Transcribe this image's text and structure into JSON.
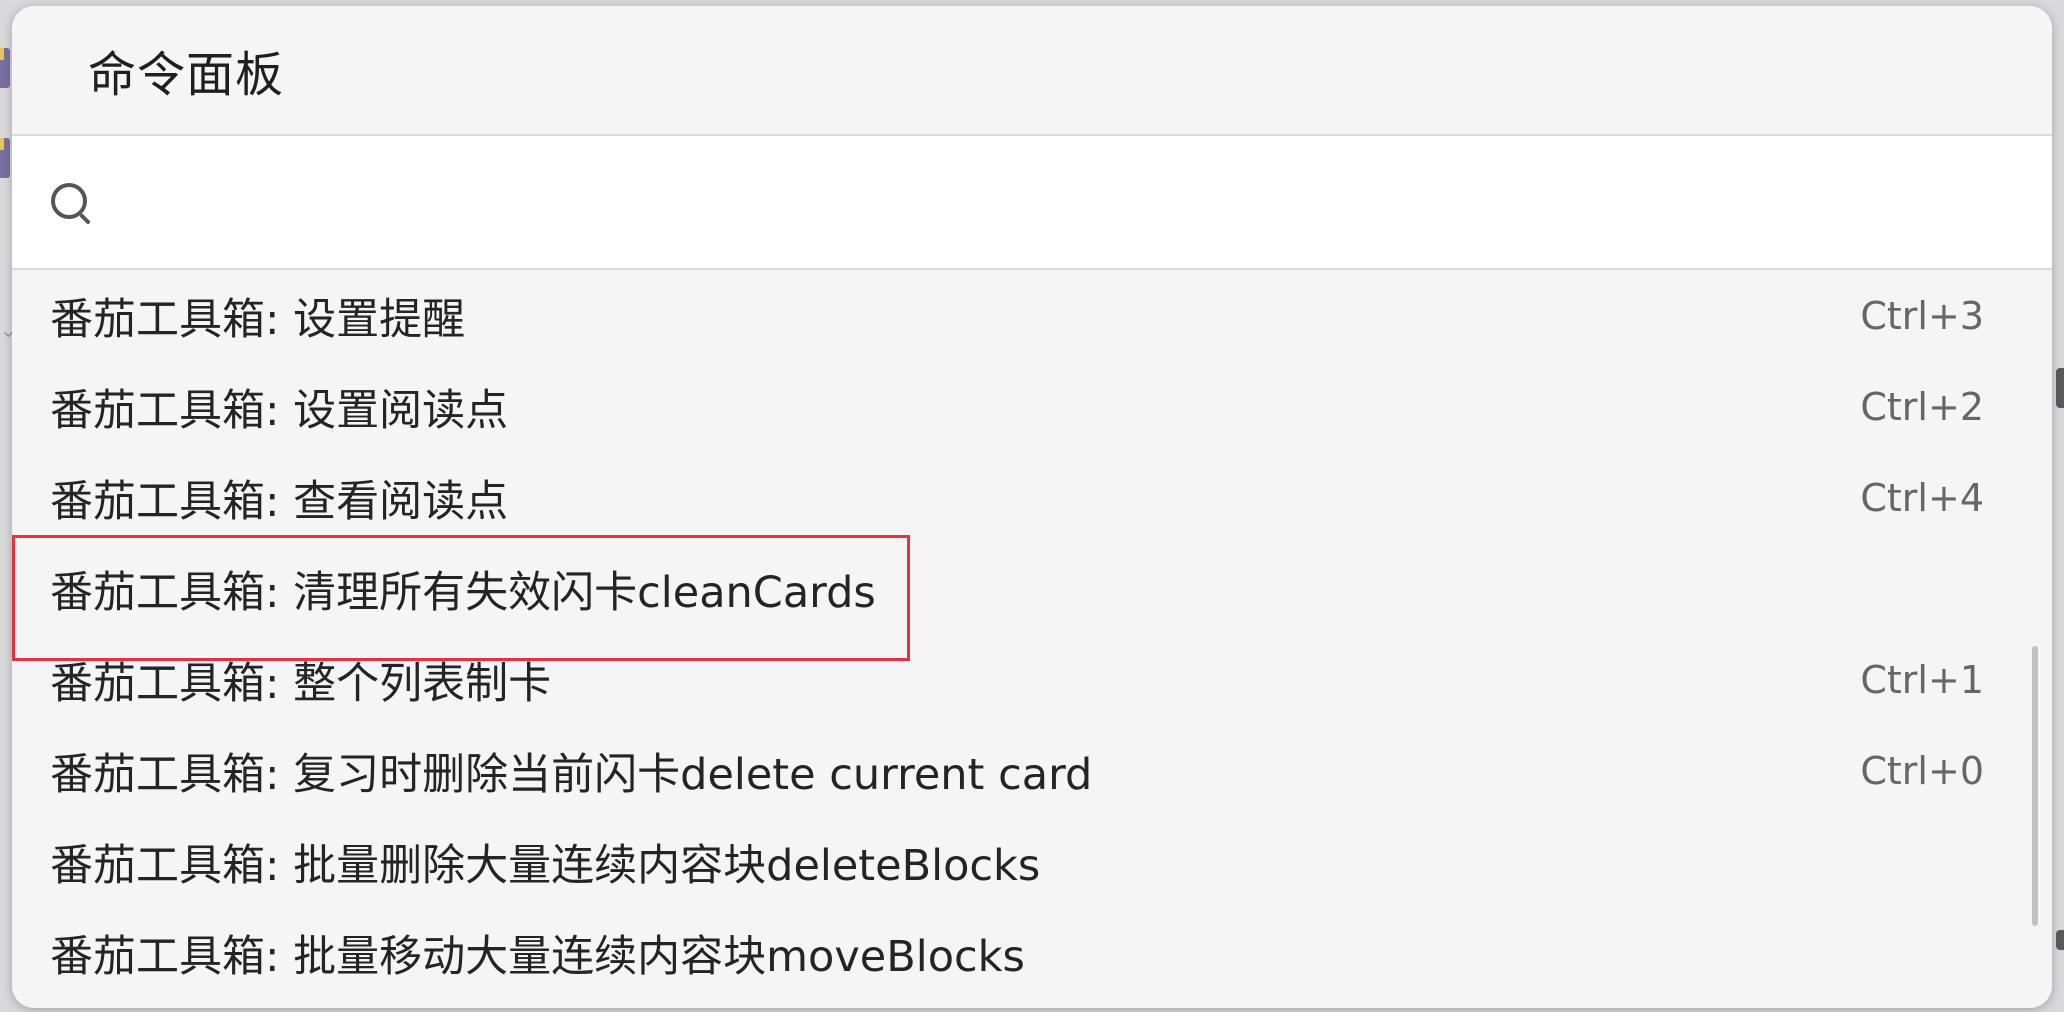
{
  "palette": {
    "title": "命令面板",
    "search": {
      "value": "",
      "placeholder": ""
    },
    "commands": [
      {
        "label": "番茄工具箱: 设置提醒",
        "shortcut": "Ctrl+3"
      },
      {
        "label": "番茄工具箱: 设置阅读点",
        "shortcut": "Ctrl+2"
      },
      {
        "label": "番茄工具箱: 查看阅读点",
        "shortcut": "Ctrl+4"
      },
      {
        "label": "番茄工具箱: 清理所有失效闪卡cleanCards",
        "shortcut": ""
      },
      {
        "label": "番茄工具箱: 整个列表制卡",
        "shortcut": "Ctrl+1"
      },
      {
        "label": "番茄工具箱: 复习时删除当前闪卡delete current card",
        "shortcut": "Ctrl+0"
      },
      {
        "label": "番茄工具箱: 批量删除大量连续内容块deleteBlocks",
        "shortcut": ""
      },
      {
        "label": "番茄工具箱: 批量移动大量连续内容块moveBlocks",
        "shortcut": ""
      }
    ]
  },
  "colors": {
    "highlight_border": "#e0353f",
    "panel_bg": "#f5f5f5",
    "search_bg": "#ffffff"
  },
  "icons": {
    "search": "search-icon"
  }
}
